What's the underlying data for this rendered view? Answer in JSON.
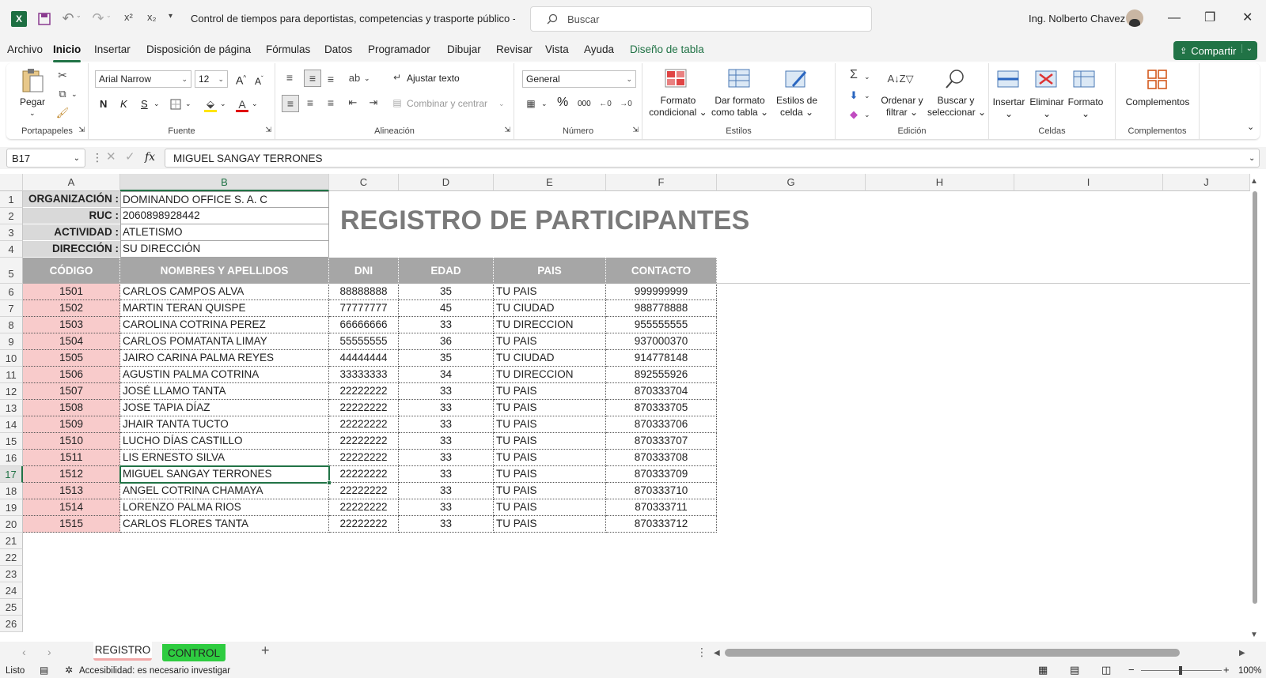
{
  "window": {
    "title": "Control de tiempos para deportistas, competencias y trasporte público  -  E...",
    "search_placeholder": "Buscar",
    "user": "Ing. Nolberto Chavez"
  },
  "menu": [
    "Archivo",
    "Inicio",
    "Insertar",
    "Disposición de página",
    "Fórmulas",
    "Datos",
    "Programador",
    "Dibujar",
    "Revisar",
    "Vista",
    "Ayuda",
    "Diseño de tabla"
  ],
  "share_label": "Compartir",
  "ribbon": {
    "groups": [
      "Portapapeles",
      "Fuente",
      "Alineación",
      "Número",
      "Estilos",
      "Edición",
      "Celdas",
      "Complementos"
    ],
    "paste": "Pegar",
    "font_name": "Arial Narrow",
    "font_size": "12",
    "bold": "N",
    "italic": "K",
    "underline": "S",
    "wrap": "Ajustar texto",
    "merge": "Combinar y centrar",
    "number_format": "General",
    "percent": "%",
    "thousands": "000",
    "cond_format": [
      "Formato",
      "condicional"
    ],
    "table_format": [
      "Dar formato",
      "como tabla"
    ],
    "cell_styles": [
      "Estilos de",
      "celda"
    ],
    "sort_filter": [
      "Ordenar y",
      "filtrar"
    ],
    "find_select": [
      "Buscar y",
      "seleccionar"
    ],
    "insert": "Insertar",
    "delete": "Eliminar",
    "format": "Formato",
    "addins": "Complementos"
  },
  "formula": {
    "name_box": "B17",
    "fx": "fx",
    "content": "MIGUEL SANGAY TERRONES"
  },
  "columns": [
    "A",
    "B",
    "C",
    "D",
    "E",
    "F",
    "G",
    "H",
    "I",
    "J"
  ],
  "rows": [
    "1",
    "2",
    "3",
    "4",
    "5",
    "6",
    "7",
    "8",
    "9",
    "10",
    "11",
    "12",
    "13",
    "14",
    "15",
    "16",
    "17",
    "18",
    "19",
    "20",
    "21",
    "22",
    "23",
    "24",
    "25",
    "26"
  ],
  "info": [
    {
      "label": "ORGANIZACIÓN :",
      "value": "DOMINANDO OFFICE S. A. C"
    },
    {
      "label": "RUC :",
      "value": "2060898928442"
    },
    {
      "label": "ACTIVIDAD :",
      "value": "ATLETISMO"
    },
    {
      "label": "DIRECCIÓN :",
      "value": "SU DIRECCIÓN"
    }
  ],
  "report_title": "REGISTRO DE PARTICIPANTES",
  "table": {
    "headers": [
      "CÓDIGO",
      "NOMBRES Y APELLIDOS",
      "DNI",
      "EDAD",
      "PAIS",
      "CONTACTO"
    ],
    "rows": [
      [
        "1501",
        "CARLOS CAMPOS ALVA",
        "88888888",
        "35",
        "TU PAIS",
        "999999999"
      ],
      [
        "1502",
        "MARTIN TERAN QUISPE",
        "77777777",
        "45",
        "TU CIUDAD",
        "988778888"
      ],
      [
        "1503",
        "CAROLINA COTRINA PEREZ",
        "66666666",
        "33",
        "TU DIRECCION",
        "955555555"
      ],
      [
        "1504",
        "CARLOS POMATANTA LIMAY",
        "55555555",
        "36",
        "TU PAIS",
        "937000370"
      ],
      [
        "1505",
        "JAIRO CARINA PALMA REYES",
        "44444444",
        "35",
        "TU CIUDAD",
        "914778148"
      ],
      [
        "1506",
        "AGUSTIN PALMA COTRINA",
        "33333333",
        "34",
        "TU DIRECCION",
        "892555926"
      ],
      [
        "1507",
        "JOSÉ LLAMO TANTA",
        "22222222",
        "33",
        "TU PAIS",
        "870333704"
      ],
      [
        "1508",
        "JOSE TAPIA DÍAZ",
        "22222222",
        "33",
        "TU PAIS",
        "870333705"
      ],
      [
        "1509",
        "JHAIR TANTA TUCTO",
        "22222222",
        "33",
        "TU PAIS",
        "870333706"
      ],
      [
        "1510",
        "LUCHO DÍAS CASTILLO",
        "22222222",
        "33",
        "TU PAIS",
        "870333707"
      ],
      [
        "1511",
        "LIS ERNESTO SILVA",
        "22222222",
        "33",
        "TU PAIS",
        "870333708"
      ],
      [
        "1512",
        "MIGUEL SANGAY TERRONES",
        "22222222",
        "33",
        "TU PAIS",
        "870333709"
      ],
      [
        "1513",
        "ANGEL COTRINA CHAMAYA",
        "22222222",
        "33",
        "TU PAIS",
        "870333710"
      ],
      [
        "1514",
        "LORENZO PALMA RIOS",
        "22222222",
        "33",
        "TU PAIS",
        "870333711"
      ],
      [
        "1515",
        "CARLOS FLORES TANTA",
        "22222222",
        "33",
        "TU PAIS",
        "870333712"
      ]
    ]
  },
  "sheets": [
    "REGISTRO",
    "CONTROL"
  ],
  "status": {
    "ready": "Listo",
    "accessibility": "Accesibilidad: es necesario investigar",
    "zoom": "100%"
  },
  "colors": {
    "excel_green": "#217346",
    "header_fill": "#a6a6a6",
    "code_fill": "#f8cbcb",
    "info_fill": "#d9d9d9",
    "control_tab": "#2ecc40"
  }
}
